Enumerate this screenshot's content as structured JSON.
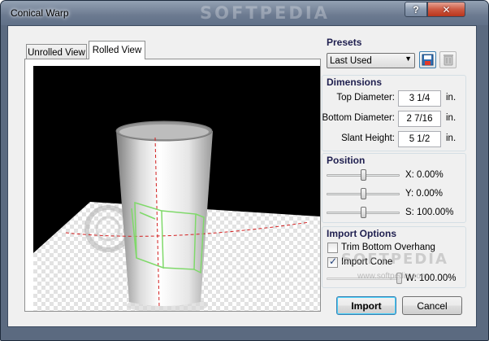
{
  "window": {
    "title": "Conical Warp",
    "watermark": "SOFTPEDIA",
    "help_label": "?",
    "close_label": "✕"
  },
  "tabs": [
    {
      "label": "Unrolled View",
      "active": false
    },
    {
      "label": "Rolled View",
      "active": true
    }
  ],
  "presets": {
    "title": "Presets",
    "selected": "Last Used"
  },
  "dimensions": {
    "title": "Dimensions",
    "top_diameter": {
      "label": "Top Diameter:",
      "value": "3 1/4",
      "unit": "in."
    },
    "bottom_diameter": {
      "label": "Bottom Diameter:",
      "value": "2 7/16",
      "unit": "in."
    },
    "slant_height": {
      "label": "Slant Height:",
      "value": "5 1/2",
      "unit": "in."
    }
  },
  "position": {
    "title": "Position",
    "x": {
      "label": "X: 0.00%",
      "level": 0.5
    },
    "y": {
      "label": "Y: 0.00%",
      "level": 0.5
    },
    "s": {
      "label": "S: 100.00%",
      "level": 0.5
    }
  },
  "import_options": {
    "title": "Import Options",
    "trim_bottom_overhang": {
      "label": "Trim Bottom Overhang",
      "checked": false
    },
    "import_cone": {
      "label": "Import Cone",
      "checked": true
    },
    "width": {
      "label": "W: 100.00%",
      "level": 1.0
    },
    "watermark": "SOFTPEDIA",
    "watermark_url": "www.softpedia.com"
  },
  "buttons": {
    "import": "Import",
    "cancel": "Cancel"
  },
  "colors": {
    "accent": "#3c7fb1",
    "group_title": "#1f1f4f",
    "viewport_bg": "#000000",
    "guide_line": "#d32020",
    "art_outline": "#7fd96a"
  }
}
